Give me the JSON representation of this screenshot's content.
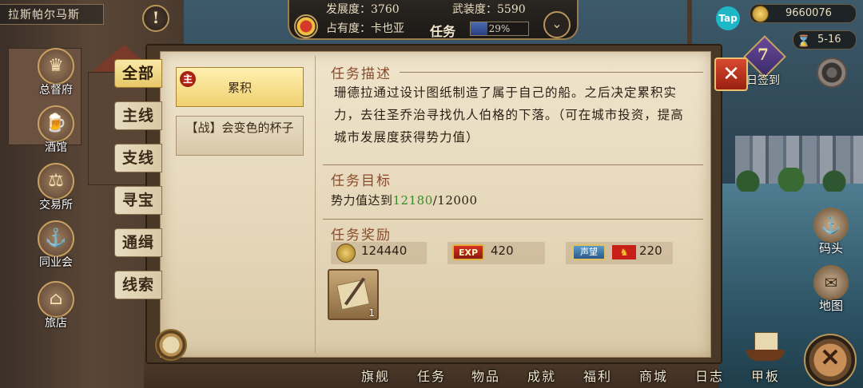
{
  "hud": {
    "city_name": "拉斯帕尔马斯",
    "alert_label": "!",
    "development_label": "发展度：3760",
    "armament_label": "武装度：5590",
    "occupancy_label": "占有度：卡也亚",
    "mission_label": "任务",
    "mission_progress_text": "29%",
    "mission_progress_value": 0.29,
    "tap_label": "Tap",
    "gold": "9660076",
    "date": "5-16",
    "daily_num": "7",
    "daily_label": "日签到"
  },
  "left_menu": [
    {
      "label": "总督府",
      "icon": "crown-icon",
      "glyph": "♛"
    },
    {
      "label": "酒馆",
      "icon": "beer-mug-icon",
      "glyph": "🍺"
    },
    {
      "label": "交易所",
      "icon": "scales-icon",
      "glyph": "⚖"
    },
    {
      "label": "同业会",
      "icon": "anchor-icon",
      "glyph": "⚓"
    },
    {
      "label": "旅店",
      "icon": "basket-icon",
      "glyph": "⌂"
    }
  ],
  "right_menu": [
    {
      "label": "码头",
      "icon": "dock-icon",
      "glyph": "⚓"
    },
    {
      "label": "地图",
      "icon": "map-scroll-icon",
      "glyph": "✉"
    }
  ],
  "bottom_nav": [
    "旗舰",
    "任务",
    "物品",
    "成就",
    "福利",
    "商城",
    "日志",
    "甲板"
  ],
  "tabs": [
    "全部",
    "主线",
    "支线",
    "寻宝",
    "通缉",
    "线索"
  ],
  "quests": [
    {
      "badge": "主",
      "title": "累积"
    },
    {
      "title": "【战】会变色的杯子"
    }
  ],
  "detail": {
    "desc_title": "任务描述",
    "description": "珊德拉通过设计图纸制造了属于自己的船。之后决定累积实力，去往圣乔治寻找仇人伯格的下落。（可在城市投资，提高城市发展度获得势力值）",
    "target_title": "任务目标",
    "target_prefix": "势力值达到",
    "target_current": "12180",
    "target_total": "/12000",
    "reward_title": "任务奖励",
    "rewards": {
      "gold": "124440",
      "exp_label": "EXP",
      "exp": "420",
      "reputation_label": "声望",
      "reputation": "220"
    },
    "item_count": "1"
  },
  "colors": {
    "panel": "#efe4cc",
    "title": "#8a4a2a",
    "highlight_green": "#3a8a2a",
    "close_red": "#d84a30"
  }
}
